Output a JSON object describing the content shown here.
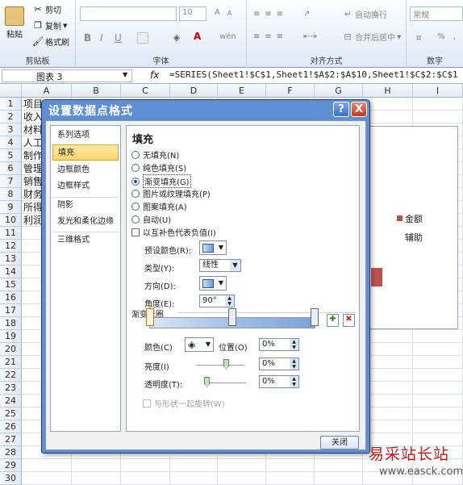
{
  "ribbon": {
    "clipboard": {
      "paste": "粘贴",
      "cut": "剪切",
      "copy": "复制",
      "format_painter": "格式刷",
      "label": "剪贴板"
    },
    "font": {
      "size": "10",
      "bold": "B",
      "italic": "I",
      "underline": "U",
      "font_color_letter": "A",
      "grow": "A",
      "shrink": "A",
      "phonetic": "wén",
      "label": "字体"
    },
    "alignment": {
      "wrap": "自动换行",
      "merge": "合并后居中",
      "label": "对齐方式"
    },
    "number": {
      "format": "常规",
      "percent": "%",
      "comma": ",",
      "label": "数字"
    }
  },
  "formula_bar": {
    "name_box": "图表 3",
    "fx": "fx",
    "formula": "=SERIES(Sheet1!$C$1,Sheet1!$A$2:$A$10,Sheet1!$C$2:$C$1"
  },
  "columns": [
    "A",
    "B",
    "C",
    "D",
    "E",
    "F",
    "G",
    "H",
    "I"
  ],
  "rows": [
    "1",
    "2",
    "3",
    "4",
    "5",
    "6",
    "7",
    "8",
    "9",
    "10",
    "11",
    "12",
    "13",
    "14",
    "15",
    "16",
    "17",
    "18",
    "19",
    "20",
    "21",
    "22",
    "23",
    "24",
    "25",
    "26",
    "27",
    "28",
    "29",
    "30"
  ],
  "cells_a": [
    "项目",
    "收入",
    "材料",
    "人工",
    "制作",
    "管理",
    "销售",
    "财务",
    "所得",
    "利润"
  ],
  "chart": {
    "legend_1": "金额",
    "legend_2": "辅助",
    "colors": {
      "series_1": "#c0504d"
    }
  },
  "dialog": {
    "title": "设置数据点格式",
    "help": "?",
    "close_x": "X",
    "nav": [
      "系列选项",
      "填充",
      "边框颜色",
      "边框样式",
      "阴影",
      "发光和柔化边缘",
      "三维格式"
    ],
    "selected_nav": "填充",
    "panel_title": "填充",
    "fill_options": [
      "无填充(N)",
      "纯色填充(S)",
      "渐变填充(G)",
      "图片或纹理填充(P)",
      "图案填充(A)",
      "自动(U)"
    ],
    "selected_fill": "渐变填充(G)",
    "invert_negative": "以互补色代表负值(I)",
    "preset_colors_label": "预设颜色(R):",
    "type_label": "类型(Y):",
    "type_value": "线性",
    "direction_label": "方向(D):",
    "angle_label": "角度(E):",
    "angle_value": "90°",
    "gradient_stops_label": "渐变光圈",
    "color_label": "颜色(C)",
    "position_label": "位置(O)",
    "position_value": "0%",
    "brightness_label": "亮度(I)",
    "brightness_value": "0%",
    "transparency_label": "透明度(T):",
    "transparency_value": "0%",
    "rotate_with_shape": "与形状一起旋转(W)",
    "close_button": "关闭",
    "gradient_stops": [
      0,
      0.5,
      1
    ]
  },
  "watermark": {
    "cn": "易采站长站",
    "url": "www.easck.com"
  }
}
